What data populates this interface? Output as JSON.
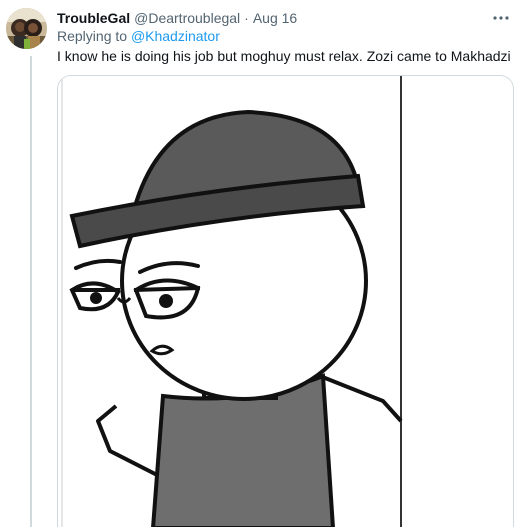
{
  "tweet": {
    "display_name": "TroubleGal",
    "handle": "@Deartroublegal",
    "separator": "·",
    "date": "Aug 16",
    "replying_prefix": "Replying to ",
    "replying_to": "@Khadzinator",
    "text": "I know he is doing his job but moghuy must relax. Zozi came to Makhadzi"
  },
  "icons": {
    "more": "more-horizontal-icon",
    "avatar": "avatar-photo"
  },
  "colors": {
    "text": "#0f1419",
    "secondary": "#536471",
    "link": "#1d9bf0",
    "border": "#cfd9de",
    "beanie": "#5a5a5a",
    "shirt": "#6e6e6e"
  }
}
